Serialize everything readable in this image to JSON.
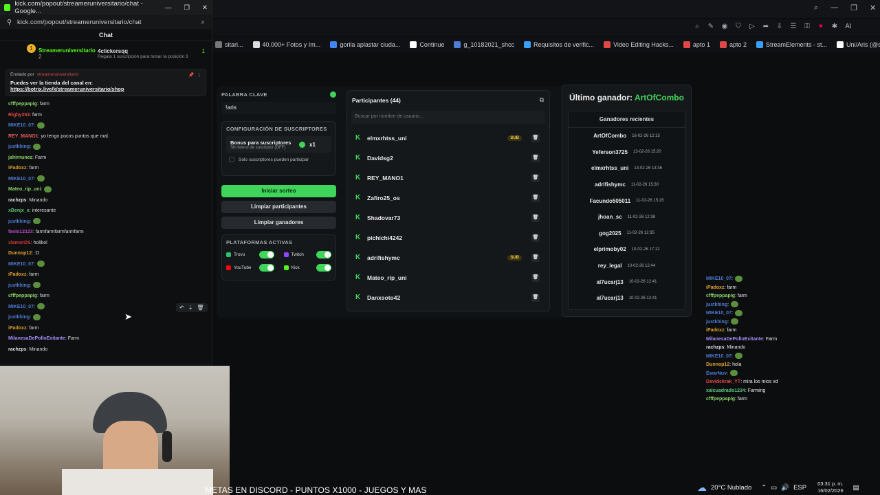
{
  "popup": {
    "title": "kick.com/popout/streameruniversitario/chat - Google...",
    "url": "kick.com/popout/streameruniversitario/chat",
    "chat_header": "Chat",
    "top_user": "Streameruniversitario",
    "top_user_sub": "2",
    "top_other": "4clickersqq",
    "top_other_count": "1",
    "top_note": "Regala 1 suscripción para tomar la posición 3",
    "pinned_by": "Enviado por",
    "pinned_user": "streameruniversitario",
    "pinned_text": "Puedes ver la tienda del canal en:",
    "pinned_link": "https://botrix.live/k/streameruniversitario/shop",
    "messages": [
      {
        "u": "cfffpeppapig",
        "c": "#8bd16a",
        "t": ": farm"
      },
      {
        "u": "Rigby253",
        "c": "#e04848",
        "t": ": farm"
      },
      {
        "u": "MIKE10_07",
        "c": "#4d7cd6",
        "t": ":",
        "e": true
      },
      {
        "u": "REY_MANO1",
        "c": "#e85a5a",
        "t": ": yo tengo pocos puntos que mal."
      },
      {
        "u": "justkhing",
        "c": "#4d7cd6",
        "t": ":",
        "e": true
      },
      {
        "u": "jahirnunez",
        "c": "#8bd16a",
        "t": ": Farm"
      },
      {
        "u": "iPadoxz",
        "c": "#e0a030",
        "t": ": farm"
      },
      {
        "u": "MIKE10_07",
        "c": "#4d7cd6",
        "t": ":",
        "e": true
      },
      {
        "u": "Mateo_rip_uni",
        "c": "#8bd16a",
        "t": ":",
        "e": true
      },
      {
        "u": "rachzps",
        "c": "#e0e0e0",
        "t": ": Minando"
      },
      {
        "u": "xBenjx_x",
        "c": "#5cc27a",
        "t": ": interesante"
      },
      {
        "u": "justkhing",
        "c": "#4d7cd6",
        "t": ":",
        "e": true
      },
      {
        "u": "favio12123",
        "c": "#c04ad0",
        "t": ": farmfarmfarmfarmfarm"
      },
      {
        "u": "xlamorDS",
        "c": "#d03a3a",
        "t": ": holibol"
      },
      {
        "u": "Dunnop12",
        "c": "#e0a030",
        "t": ": :D"
      },
      {
        "u": "MIKE10_07",
        "c": "#4d7cd6",
        "t": ":",
        "e": true
      },
      {
        "u": "iPadoxz",
        "c": "#e0a030",
        "t": ": farm"
      },
      {
        "u": "justkhing",
        "c": "#4d7cd6",
        "t": ":",
        "e": true
      },
      {
        "u": "cfffpeppapig",
        "c": "#8bd16a",
        "t": ": farm"
      },
      {
        "u": "MIKE10_07",
        "c": "#4d7cd6",
        "t": ":",
        "e": true
      },
      {
        "u": "justkhing",
        "c": "#4d7cd6",
        "t": ":",
        "e": true
      },
      {
        "u": "iPadoxz",
        "c": "#e0a030",
        "t": ": farm"
      },
      {
        "u": "MilanesaDePolloExitante",
        "c": "#a78bfa",
        "t": ": Farm"
      },
      {
        "u": "rachzps",
        "c": "#e0e0e0",
        "t": ": Minando"
      }
    ]
  },
  "bookmarks": [
    "sitari...",
    "40.000+ Fotos y Im...",
    "gorila aplastar ciuda...",
    "Continue",
    "g_10182021_shcc",
    "Requisitos de verific...",
    "Video Editing Hacks...",
    "apto 1",
    "apto 2",
    "StreamElements - st...",
    "Uni/Aris (@streame..."
  ],
  "left_panel": {
    "keyword_label": "PALABRA CLAVE",
    "keyword_value": "!aris",
    "subs_label": "CONFIGURACIÓN DE SUSCRIPTORES",
    "bonus_title": "Bonus para suscriptores",
    "bonus_sub": "Sin bonus de suscriptor (OFF)",
    "bonus_mult": "x1",
    "only_subs": "Solo suscriptores pueden participar",
    "start": "Iniciar sorteo",
    "clear_participants": "Limpiar participantes",
    "clear_winners": "Limpiar ganadores",
    "platforms_label": "PLATAFORMAS ACTIVAS",
    "platforms": [
      {
        "name": "Trovo",
        "color": "#2fbf71"
      },
      {
        "name": "Twitch",
        "color": "#9146ff"
      },
      {
        "name": "YouTube",
        "color": "#ff0000"
      },
      {
        "name": "Kick",
        "color": "#53fc18"
      }
    ]
  },
  "participants": {
    "title": "Participantes (44)",
    "search_placeholder": "Buscar por nombre de usuario...",
    "list": [
      {
        "name": "elmxrhtss_uni",
        "sub": "SUB"
      },
      {
        "name": "Davidsg2"
      },
      {
        "name": "REY_MANO1"
      },
      {
        "name": "Zafiro25_os"
      },
      {
        "name": "Shadovar73"
      },
      {
        "name": "pichichi4242"
      },
      {
        "name": "adrifishymc",
        "sub": "SUB"
      },
      {
        "name": "Mateo_rip_uni"
      },
      {
        "name": "Danxsoto42"
      }
    ]
  },
  "winners": {
    "last_label": "Último ganador:",
    "last_name": "ArtOfCombo",
    "recent_label": "Ganadores recientes",
    "list": [
      {
        "n": "ArtOfCombo",
        "d": "16-02-26 12:15"
      },
      {
        "n": "Yeferson3725",
        "d": "13-02-26 15:20"
      },
      {
        "n": "elmxrhtss_uni",
        "d": "13-02-26 13:36"
      },
      {
        "n": "adrifishymc",
        "d": "11-02-26 15:30"
      },
      {
        "n": "Facundo505011",
        "d": "11-02-26 15:26"
      },
      {
        "n": "jhoan_sc",
        "d": "11-02-26 12:38"
      },
      {
        "n": "gog2025",
        "d": "11-02-26 12:35"
      },
      {
        "n": "elprimoby02",
        "d": "10-02-26 17:12"
      },
      {
        "n": "rey_legal",
        "d": "10-02-26 12:44"
      },
      {
        "n": "al7ucarj13",
        "d": "10-02-26 12:41"
      },
      {
        "n": "al7ucarj13",
        "d": "10-02-26 12:41"
      }
    ]
  },
  "overlay_chat": [
    {
      "u": "MIKE10_07",
      "c": "#4d7cd6",
      "t": ":",
      "e": true
    },
    {
      "u": "iPadoxz",
      "c": "#e0a030",
      "t": ": farm"
    },
    {
      "u": "cfffpeppapig",
      "c": "#8bd16a",
      "t": ": farm"
    },
    {
      "u": "justkhing",
      "c": "#4d7cd6",
      "t": ":",
      "e": true
    },
    {
      "u": "MIKE10_07",
      "c": "#4d7cd6",
      "t": ":",
      "e": true
    },
    {
      "u": "justkhing",
      "c": "#4d7cd6",
      "t": ":",
      "e": true
    },
    {
      "u": "iPadoxz",
      "c": "#e0a030",
      "t": ": farm"
    },
    {
      "u": "MilanesaDePolloExitante",
      "c": "#a78bfa",
      "t": ": Farm"
    },
    {
      "u": "rachzps",
      "c": "#e0e0e0",
      "t": ": Minando"
    },
    {
      "u": "MIKE10_07",
      "c": "#4d7cd6",
      "t": ":",
      "e": true
    },
    {
      "u": "Dunnop12",
      "c": "#e0a030",
      "t": ": hola"
    },
    {
      "u": "EwarNuv",
      "c": "#4d7cd6",
      "t": ":",
      "e": true
    },
    {
      "u": "Davidckrak_YT",
      "c": "#e04848",
      "t": ": mira los mios xd"
    },
    {
      "u": "xalcuadrado1234",
      "c": "#5cc27a",
      "t": ": Farming"
    },
    {
      "u": "cfffpeppapig",
      "c": "#8bd16a",
      "t": ": farm"
    }
  ],
  "taskbar": {
    "weather": "20°C Nublado",
    "lang": "ESP",
    "time": "03:31 p. m.",
    "date": "16/02/2026"
  },
  "ticker": "METAS EN DISCORD - PUNTOS X1000 - JUEGOS Y MAS"
}
